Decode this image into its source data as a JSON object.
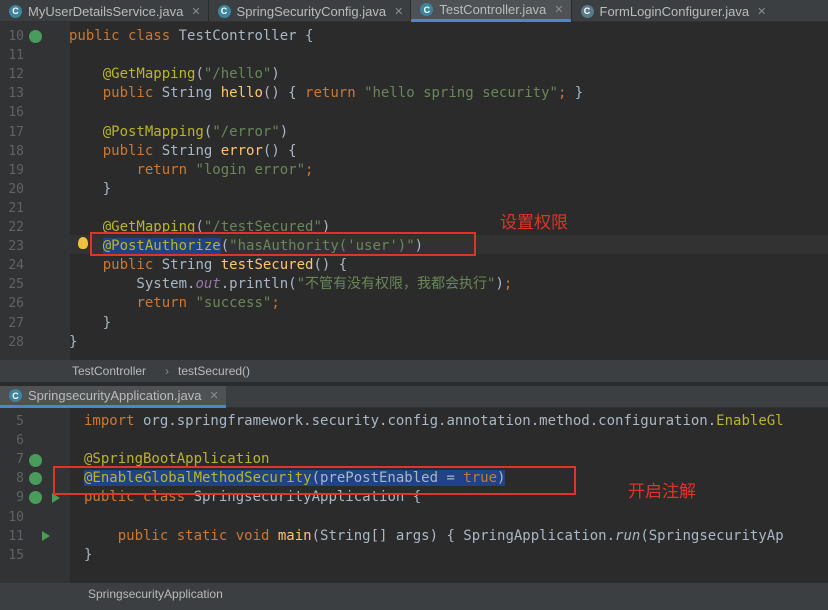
{
  "tabs": [
    {
      "label": "MyUserDetailsService.java",
      "active": false
    },
    {
      "label": "SpringSecurityConfig.java",
      "active": false
    },
    {
      "label": "TestController.java",
      "active": true
    },
    {
      "label": "FormLoginConfigurer.java",
      "active": false
    }
  ],
  "editor1": {
    "lines": [
      {
        "n": "10",
        "html": "<span class=\"kw\">public class</span> TestController {"
      },
      {
        "n": "11",
        "html": ""
      },
      {
        "n": "12",
        "html": "    <span class=\"an\">@GetMapping</span>(<span class=\"st\">\"/hello\"</span>)"
      },
      {
        "n": "13",
        "html": "    <span class=\"kw\">public</span> String <span class=\"fn\">hello</span>() { <span class=\"kw\">return</span> <span class=\"st\">\"hello spring security\"</span><span class=\"kw\">;</span> }"
      },
      {
        "n": "16",
        "html": ""
      },
      {
        "n": "17",
        "html": "    <span class=\"an\">@PostMapping</span>(<span class=\"st\">\"/error\"</span>)"
      },
      {
        "n": "18",
        "html": "    <span class=\"kw\">public</span> String <span class=\"fn\">error</span>() {"
      },
      {
        "n": "19",
        "html": "        <span class=\"kw\">return</span> <span class=\"st\">\"login error\"</span><span class=\"kw\">;</span>"
      },
      {
        "n": "20",
        "html": "    }"
      },
      {
        "n": "21",
        "html": ""
      },
      {
        "n": "22",
        "html": "    <span class=\"an\">@GetMapping</span>(<span class=\"st\">\"/testSecured\"</span>)"
      },
      {
        "n": "23",
        "html": "    <span class=\"an\"><span class=\"sel\">@PostAuthorize</span></span>(<span class=\"st\">\"hasAuthority(<span style=\"color:#6a8759\">'user'</span>)\"</span>)"
      },
      {
        "n": "24",
        "html": "    <span class=\"kw\">public</span> String <span class=\"fn\">testSecured</span>() {"
      },
      {
        "n": "25",
        "html": "        System.<span class=\"it\">out</span>.println(<span class=\"st\">\"不管有没有权限，我都会执行\"</span>)<span class=\"kw\">;</span>"
      },
      {
        "n": "26",
        "html": "        <span class=\"kw\">return</span> <span class=\"st\">\"success\"</span><span class=\"kw\">;</span>"
      },
      {
        "n": "27",
        "html": "    }"
      },
      {
        "n": "28",
        "html": "}"
      }
    ],
    "annotation": "设置权限"
  },
  "breadcrumb1": {
    "class": "TestController",
    "sep": "›",
    "method": "testSecured()"
  },
  "tab2": {
    "label": "SpringsecurityApplication.java"
  },
  "editor2": {
    "lines": [
      {
        "n": "5",
        "html": "<span class=\"kw\">import</span> org.springframework.security.config.annotation.method.configuration.<span class=\"an\">EnableGl</span>"
      },
      {
        "n": "6",
        "html": ""
      },
      {
        "n": "7",
        "html": "<span class=\"an\">@SpringBootApplication</span>"
      },
      {
        "n": "8",
        "html": "<span class=\"an sel\">@EnableGlobalMethodSecurity</span><span class=\"sel\">(prePostEnabled = <span class=\"kw\">true</span>)</span>"
      },
      {
        "n": "9",
        "html": "<span class=\"kw\">public class</span> SpringsecurityApplication {"
      },
      {
        "n": "10",
        "html": ""
      },
      {
        "n": "11",
        "html": "    <span class=\"kw\">public static void</span> <span class=\"fn\">main</span>(String[] args) { SpringApplication.<span class=\"it\" style=\"color:#a9b7c6\">run</span>(SpringsecurityAp"
      },
      {
        "n": "15",
        "html": "}"
      }
    ],
    "annotation": "开启注解"
  },
  "breadcrumb2": {
    "class": "SpringsecurityApplication"
  }
}
